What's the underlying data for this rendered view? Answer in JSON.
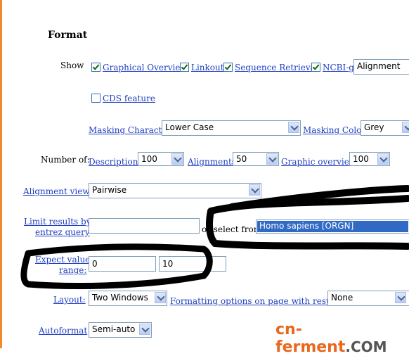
{
  "format": {
    "title": "Format",
    "show_label": "Show",
    "show_options": [
      {
        "label": "Graphical Overview",
        "checked": true
      },
      {
        "label": "Linkout",
        "checked": true
      },
      {
        "label": "Sequence Retrieval",
        "checked": true
      },
      {
        "label": "NCBI-gi",
        "checked": true
      }
    ],
    "ncbi_select_value": "Alignment",
    "cds_label": "CDS feature",
    "cds_checked": false,
    "masking_character_label": "Masking Character",
    "masking_character_value": "Lower Case",
    "masking_color_label": "Masking Color",
    "masking_color_value": "Grey",
    "number_of_label": "Number of:",
    "descriptions_label": "Descriptions",
    "descriptions_value": "100",
    "alignments_label": "Alignments",
    "alignments_value": "50",
    "graphic_overview_label": "Graphic overview",
    "graphic_overview_value": "100",
    "alignment_view_label": "Alignment view",
    "alignment_view_value": "Pairwise",
    "limit_label_line1": "Limit results by",
    "limit_label_line2": "entrez query",
    "limit_input_value": "",
    "or_select_from": "or select from:",
    "organism_value": "Homo sapiens [ORGN]",
    "expect_label_line1": "Expect value",
    "expect_label_line2": "range:",
    "expect_min": "0",
    "expect_max": "10",
    "layout_label": "Layout:",
    "layout_value": "Two Windows",
    "formatting_options_label": "Formatting options on page with results:",
    "formatting_options_value": "None",
    "autoformat_label": "Autoformat",
    "autoformat_value": "Semi-auto"
  },
  "watermark": {
    "main": "cn-ferment",
    "suffix": ".COM"
  },
  "colors": {
    "link": "#1f3fbf",
    "left_border": "#f08a2a",
    "watermark": "#e8681c",
    "selected_option_bg": "#316ac5"
  }
}
